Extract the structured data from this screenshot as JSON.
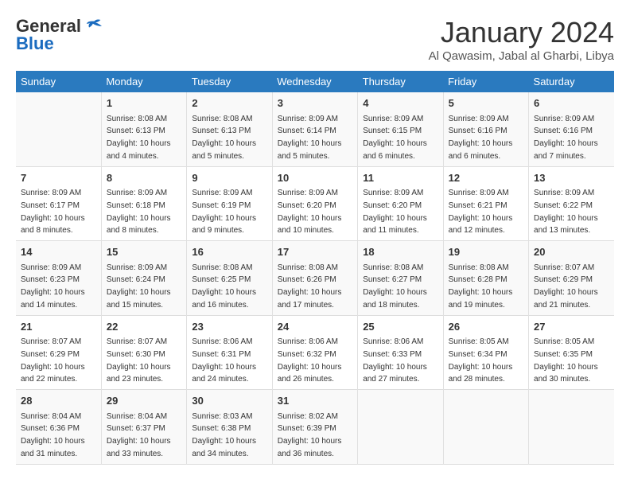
{
  "logo": {
    "general": "General",
    "blue": "Blue"
  },
  "title": "January 2024",
  "location": "Al Qawasim, Jabal al Gharbi, Libya",
  "weekdays": [
    "Sunday",
    "Monday",
    "Tuesday",
    "Wednesday",
    "Thursday",
    "Friday",
    "Saturday"
  ],
  "weeks": [
    [
      {
        "day": "",
        "sunrise": "",
        "sunset": "",
        "daylight": ""
      },
      {
        "day": "1",
        "sunrise": "Sunrise: 8:08 AM",
        "sunset": "Sunset: 6:13 PM",
        "daylight": "Daylight: 10 hours and 4 minutes."
      },
      {
        "day": "2",
        "sunrise": "Sunrise: 8:08 AM",
        "sunset": "Sunset: 6:13 PM",
        "daylight": "Daylight: 10 hours and 5 minutes."
      },
      {
        "day": "3",
        "sunrise": "Sunrise: 8:09 AM",
        "sunset": "Sunset: 6:14 PM",
        "daylight": "Daylight: 10 hours and 5 minutes."
      },
      {
        "day": "4",
        "sunrise": "Sunrise: 8:09 AM",
        "sunset": "Sunset: 6:15 PM",
        "daylight": "Daylight: 10 hours and 6 minutes."
      },
      {
        "day": "5",
        "sunrise": "Sunrise: 8:09 AM",
        "sunset": "Sunset: 6:16 PM",
        "daylight": "Daylight: 10 hours and 6 minutes."
      },
      {
        "day": "6",
        "sunrise": "Sunrise: 8:09 AM",
        "sunset": "Sunset: 6:16 PM",
        "daylight": "Daylight: 10 hours and 7 minutes."
      }
    ],
    [
      {
        "day": "7",
        "sunrise": "Sunrise: 8:09 AM",
        "sunset": "Sunset: 6:17 PM",
        "daylight": "Daylight: 10 hours and 8 minutes."
      },
      {
        "day": "8",
        "sunrise": "Sunrise: 8:09 AM",
        "sunset": "Sunset: 6:18 PM",
        "daylight": "Daylight: 10 hours and 8 minutes."
      },
      {
        "day": "9",
        "sunrise": "Sunrise: 8:09 AM",
        "sunset": "Sunset: 6:19 PM",
        "daylight": "Daylight: 10 hours and 9 minutes."
      },
      {
        "day": "10",
        "sunrise": "Sunrise: 8:09 AM",
        "sunset": "Sunset: 6:20 PM",
        "daylight": "Daylight: 10 hours and 10 minutes."
      },
      {
        "day": "11",
        "sunrise": "Sunrise: 8:09 AM",
        "sunset": "Sunset: 6:20 PM",
        "daylight": "Daylight: 10 hours and 11 minutes."
      },
      {
        "day": "12",
        "sunrise": "Sunrise: 8:09 AM",
        "sunset": "Sunset: 6:21 PM",
        "daylight": "Daylight: 10 hours and 12 minutes."
      },
      {
        "day": "13",
        "sunrise": "Sunrise: 8:09 AM",
        "sunset": "Sunset: 6:22 PM",
        "daylight": "Daylight: 10 hours and 13 minutes."
      }
    ],
    [
      {
        "day": "14",
        "sunrise": "Sunrise: 8:09 AM",
        "sunset": "Sunset: 6:23 PM",
        "daylight": "Daylight: 10 hours and 14 minutes."
      },
      {
        "day": "15",
        "sunrise": "Sunrise: 8:09 AM",
        "sunset": "Sunset: 6:24 PM",
        "daylight": "Daylight: 10 hours and 15 minutes."
      },
      {
        "day": "16",
        "sunrise": "Sunrise: 8:08 AM",
        "sunset": "Sunset: 6:25 PM",
        "daylight": "Daylight: 10 hours and 16 minutes."
      },
      {
        "day": "17",
        "sunrise": "Sunrise: 8:08 AM",
        "sunset": "Sunset: 6:26 PM",
        "daylight": "Daylight: 10 hours and 17 minutes."
      },
      {
        "day": "18",
        "sunrise": "Sunrise: 8:08 AM",
        "sunset": "Sunset: 6:27 PM",
        "daylight": "Daylight: 10 hours and 18 minutes."
      },
      {
        "day": "19",
        "sunrise": "Sunrise: 8:08 AM",
        "sunset": "Sunset: 6:28 PM",
        "daylight": "Daylight: 10 hours and 19 minutes."
      },
      {
        "day": "20",
        "sunrise": "Sunrise: 8:07 AM",
        "sunset": "Sunset: 6:29 PM",
        "daylight": "Daylight: 10 hours and 21 minutes."
      }
    ],
    [
      {
        "day": "21",
        "sunrise": "Sunrise: 8:07 AM",
        "sunset": "Sunset: 6:29 PM",
        "daylight": "Daylight: 10 hours and 22 minutes."
      },
      {
        "day": "22",
        "sunrise": "Sunrise: 8:07 AM",
        "sunset": "Sunset: 6:30 PM",
        "daylight": "Daylight: 10 hours and 23 minutes."
      },
      {
        "day": "23",
        "sunrise": "Sunrise: 8:06 AM",
        "sunset": "Sunset: 6:31 PM",
        "daylight": "Daylight: 10 hours and 24 minutes."
      },
      {
        "day": "24",
        "sunrise": "Sunrise: 8:06 AM",
        "sunset": "Sunset: 6:32 PM",
        "daylight": "Daylight: 10 hours and 26 minutes."
      },
      {
        "day": "25",
        "sunrise": "Sunrise: 8:06 AM",
        "sunset": "Sunset: 6:33 PM",
        "daylight": "Daylight: 10 hours and 27 minutes."
      },
      {
        "day": "26",
        "sunrise": "Sunrise: 8:05 AM",
        "sunset": "Sunset: 6:34 PM",
        "daylight": "Daylight: 10 hours and 28 minutes."
      },
      {
        "day": "27",
        "sunrise": "Sunrise: 8:05 AM",
        "sunset": "Sunset: 6:35 PM",
        "daylight": "Daylight: 10 hours and 30 minutes."
      }
    ],
    [
      {
        "day": "28",
        "sunrise": "Sunrise: 8:04 AM",
        "sunset": "Sunset: 6:36 PM",
        "daylight": "Daylight: 10 hours and 31 minutes."
      },
      {
        "day": "29",
        "sunrise": "Sunrise: 8:04 AM",
        "sunset": "Sunset: 6:37 PM",
        "daylight": "Daylight: 10 hours and 33 minutes."
      },
      {
        "day": "30",
        "sunrise": "Sunrise: 8:03 AM",
        "sunset": "Sunset: 6:38 PM",
        "daylight": "Daylight: 10 hours and 34 minutes."
      },
      {
        "day": "31",
        "sunrise": "Sunrise: 8:02 AM",
        "sunset": "Sunset: 6:39 PM",
        "daylight": "Daylight: 10 hours and 36 minutes."
      },
      {
        "day": "",
        "sunrise": "",
        "sunset": "",
        "daylight": ""
      },
      {
        "day": "",
        "sunrise": "",
        "sunset": "",
        "daylight": ""
      },
      {
        "day": "",
        "sunrise": "",
        "sunset": "",
        "daylight": ""
      }
    ]
  ]
}
